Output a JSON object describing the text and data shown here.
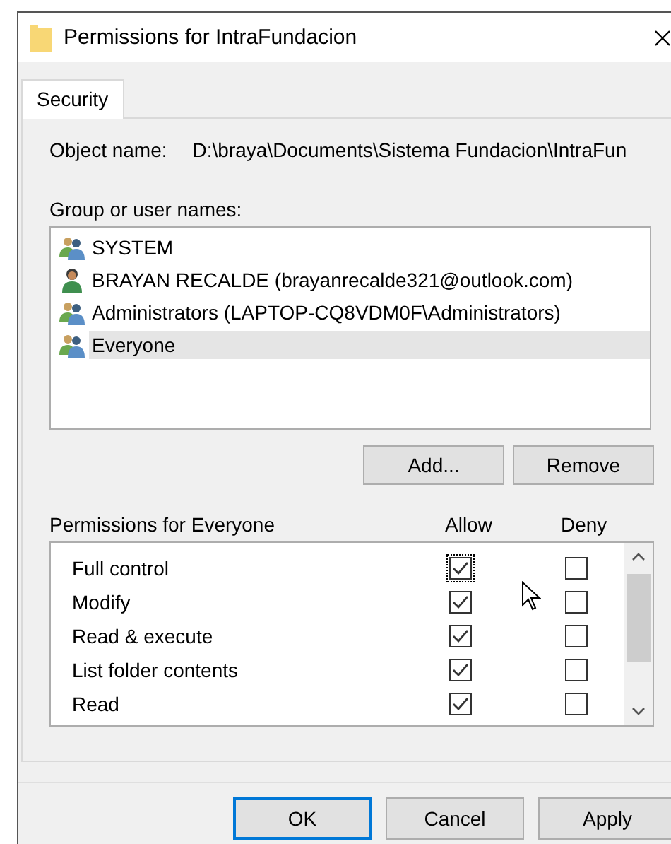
{
  "window": {
    "title": "Permissions for IntraFundacion"
  },
  "tabs": [
    {
      "label": "Security",
      "selected": true
    }
  ],
  "object_name": {
    "label": "Object name:",
    "value": "D:\\braya\\Documents\\Sistema Fundacion\\IntraFun"
  },
  "users": {
    "label": "Group or user names:",
    "items": [
      {
        "name": "SYSTEM",
        "kind": "group",
        "selected": false
      },
      {
        "name": "BRAYAN RECALDE (brayanrecalde321@outlook.com)",
        "kind": "user",
        "selected": false
      },
      {
        "name": "Administrators (LAPTOP-CQ8VDM0F\\Administrators)",
        "kind": "group",
        "selected": false
      },
      {
        "name": "Everyone",
        "kind": "group",
        "selected": true
      }
    ],
    "buttons": [
      "Add...",
      "Remove"
    ]
  },
  "permissions": {
    "label": "Permissions for Everyone",
    "allow_header": "Allow",
    "deny_header": "Deny",
    "rows": [
      {
        "name": "Full control",
        "allow": true,
        "deny": false
      },
      {
        "name": "Modify",
        "allow": true,
        "deny": false
      },
      {
        "name": "Read & execute",
        "allow": true,
        "deny": false
      },
      {
        "name": "List folder contents",
        "allow": true,
        "deny": false
      },
      {
        "name": "Read",
        "allow": true,
        "deny": false
      }
    ]
  },
  "footer_buttons": [
    {
      "label": "OK",
      "selected": true
    },
    {
      "label": "Cancel",
      "selected": false
    },
    {
      "label": "Apply",
      "selected": false
    }
  ]
}
